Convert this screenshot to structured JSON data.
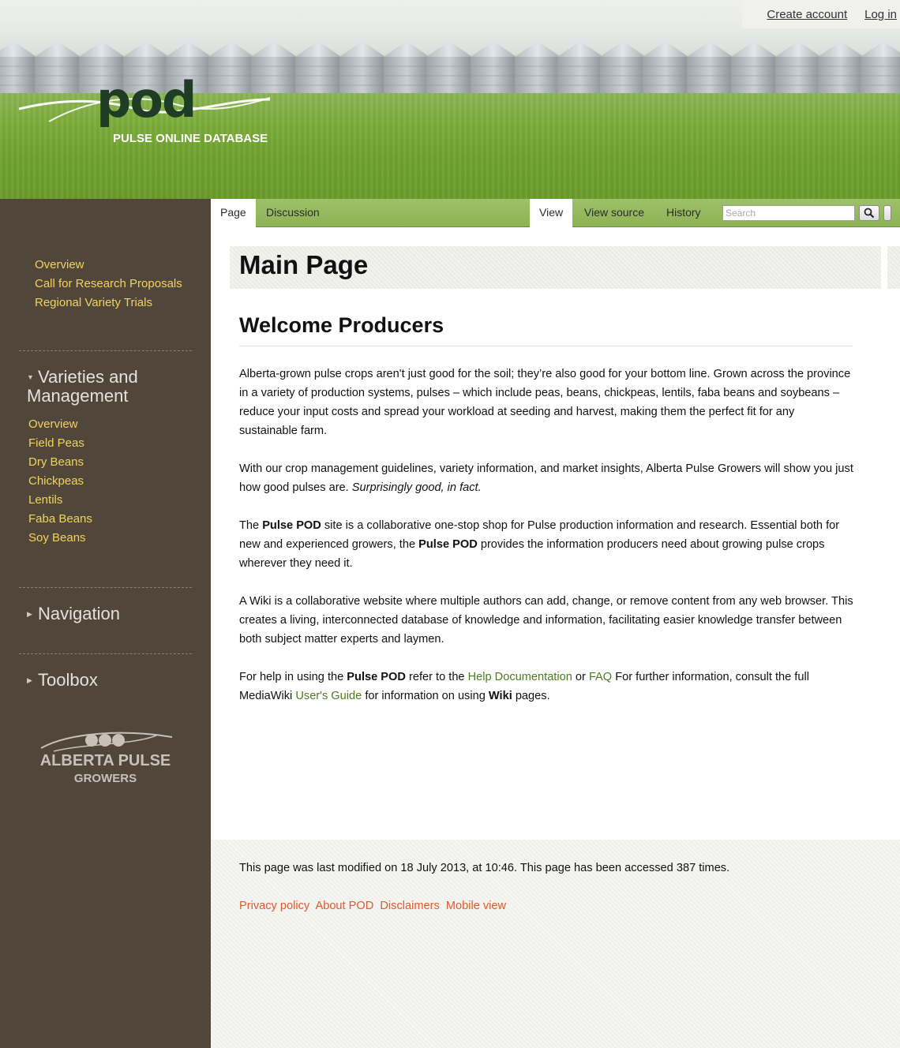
{
  "header": {
    "logo_text": "pod",
    "logo_subtitle": "PULSE ONLINE DATABASE",
    "user_links": [
      "Create account",
      "Log in"
    ]
  },
  "sidebar": {
    "top_links": [
      "Overview",
      "Call for Research Proposals",
      "Regional Variety Trials"
    ],
    "varieties": {
      "heading_line1": "Varieties and",
      "heading_line2": "Management",
      "items": [
        "Overview",
        "Field Peas",
        "Dry Beans",
        "Chickpeas",
        "Lentils",
        "Faba Beans",
        "Soy Beans"
      ]
    },
    "navigation_heading": "Navigation",
    "toolbox_heading": "Toolbox",
    "partner_logo": {
      "name": "ALBERTA PULSE",
      "sub": "GROWERS"
    }
  },
  "tabs": {
    "left": [
      "Page",
      "Discussion"
    ],
    "right": [
      "View",
      "View source",
      "History"
    ],
    "active_left": "Page",
    "active_right": "View"
  },
  "search": {
    "placeholder": "Search"
  },
  "content": {
    "title": "Main Page",
    "section_heading": "Welcome Producers",
    "p1": "Alberta-grown pulse crops aren't just good for the soil; they’re also good for your bottom line. Grown across the province in a variety of production systems, pulses – which include peas, beans, chickpeas, lentils, faba beans and soybeans – reduce your input costs and spread your workload at seeding and harvest, making them the perfect fit for any sustainable farm.",
    "p2_main": "With our crop management guidelines, variety information, and market insights, Alberta Pulse Growers will show you just how good pulses are. ",
    "p2_italic": "Surprisingly good, in fact.",
    "p3_a": "The ",
    "p3_bold1": "Pulse POD",
    "p3_b": " site is a collaborative one-stop shop for Pulse production information and research. Essential both for new and experienced growers, the ",
    "p3_bold2": "Pulse POD",
    "p3_c": " provides the information producers need about growing pulse crops wherever they need it.",
    "p4": "A Wiki is a collaborative website where multiple authors can add, change, or remove content from any web browser. This creates a living, interconnected database of knowledge and information, facilitating easier knowledge transfer between both subject matter experts and laymen.",
    "p5_a": "For help in using the ",
    "p5_bold1": "Pulse POD",
    "p5_b": " refer to the ",
    "p5_link1": "Help Documentation",
    "p5_c": " or ",
    "p5_link2": "FAQ",
    "p5_d": " For further information, consult the full MediaWiki ",
    "p5_link3": "User's Guide",
    "p5_e": " for information on using ",
    "p5_bold2": "Wiki",
    "p5_f": " pages."
  },
  "footer": {
    "info": "This page was last modified on 18 July 2013, at 10:46. This page has been accessed 387 times.",
    "links": [
      "Privacy policy",
      "About POD",
      "Disclaimers",
      "Mobile view"
    ]
  },
  "colors": {
    "sidebar_bg": "#51463a",
    "sidebar_link": "#f3d35c",
    "content_link": "#4e7a1f",
    "footer_link": "#e05a2b"
  }
}
